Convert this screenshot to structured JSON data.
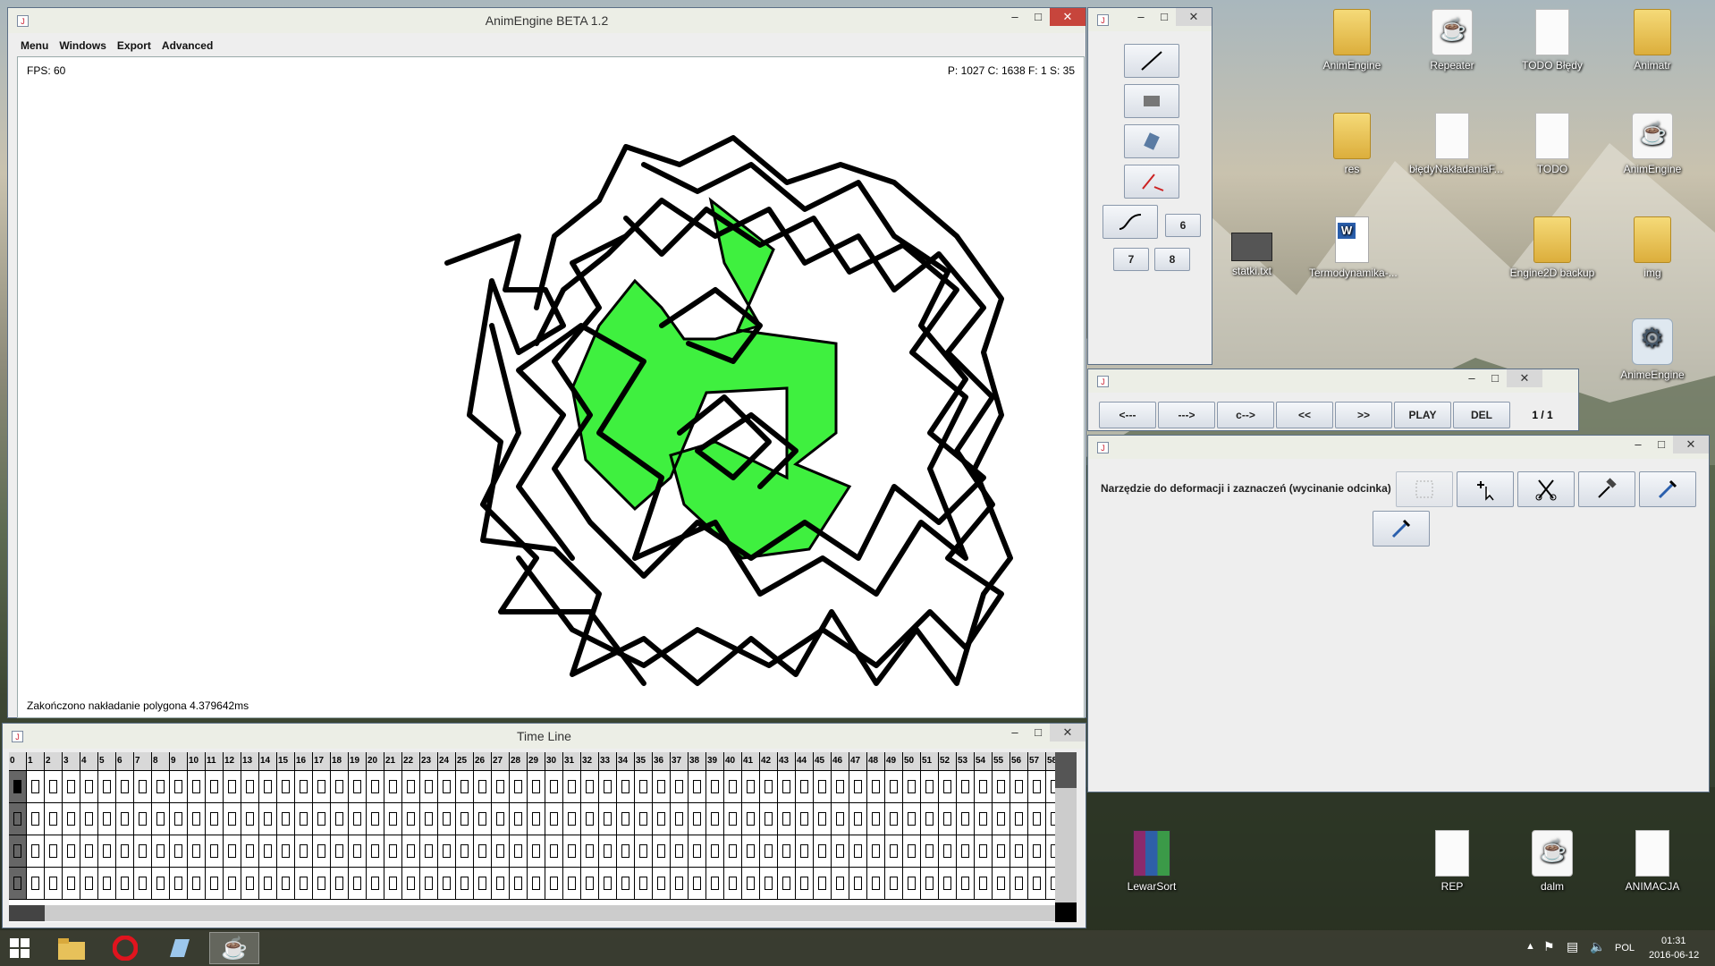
{
  "main_window": {
    "title": "AnimEngine BETA 1.2",
    "menu": [
      "Menu",
      "Windows",
      "Export",
      "Advanced"
    ],
    "fps": "FPS: 60",
    "stats": "P: 1027 C: 1638 F: 1 S: 35",
    "status": "Zakończono nakładanie polygona 4.379642ms"
  },
  "tools_window": {
    "tools": [
      "line-tool-icon",
      "image-tool-icon",
      "eraser-tool-icon",
      "pen-tool-icon",
      "curve-tool-icon"
    ],
    "numbered_buttons": [
      "6",
      "7",
      "8"
    ]
  },
  "playback_window": {
    "buttons": [
      "<---",
      "--->",
      "c-->",
      "<<",
      ">>",
      "PLAY",
      "DEL"
    ],
    "frame_counter": "1 / 1"
  },
  "deform_window": {
    "label": "Narzędzie do deformacji i zaznaczeń (wycinanie odcinka)",
    "tools": [
      "select-rect-icon",
      "add-point-icon",
      "cut-icon",
      "hammer-icon",
      "pipette-icon",
      "pipette-icon"
    ]
  },
  "timeline_window": {
    "title": "Time Line",
    "frame_numbers": [
      "0",
      "1",
      "2",
      "3",
      "4",
      "5",
      "6",
      "7",
      "8",
      "9",
      "10",
      "11",
      "12",
      "13",
      "14",
      "15",
      "16",
      "17",
      "18",
      "19",
      "20",
      "21",
      "22",
      "23",
      "24",
      "25",
      "26",
      "27",
      "28",
      "29",
      "30",
      "31",
      "32",
      "33",
      "34",
      "35",
      "36",
      "37",
      "38",
      "39",
      "40",
      "41",
      "42",
      "43",
      "44",
      "45",
      "46",
      "47",
      "48",
      "49",
      "50",
      "51",
      "52",
      "53",
      "54",
      "55",
      "56",
      "57",
      "58"
    ],
    "layer_count": 4
  },
  "desktop_icons": [
    {
      "label": "AnimEngine",
      "type": "folder"
    },
    {
      "label": "Repeater",
      "type": "java"
    },
    {
      "label": "TODO Błędy",
      "type": "doc"
    },
    {
      "label": "Animatr",
      "type": "folder"
    },
    {
      "label": "res",
      "type": "folder"
    },
    {
      "label": "błędyNakładaniaF...",
      "type": "doc"
    },
    {
      "label": "TODO",
      "type": "doc"
    },
    {
      "label": "AnimEngine",
      "type": "java"
    },
    {
      "label": "statki.txt",
      "type": "printer"
    },
    {
      "label": "Termodynamika-...",
      "type": "word"
    },
    {
      "label": "Engine2D backup",
      "type": "folder"
    },
    {
      "label": "img",
      "type": "folder"
    },
    {
      "label": "AnimeEngine",
      "type": "gear"
    },
    {
      "label": "LewarSort",
      "type": "rar"
    },
    {
      "label": "REP",
      "type": "doc"
    },
    {
      "label": "dalm",
      "type": "java"
    },
    {
      "label": "ANIMACJA",
      "type": "doc"
    }
  ],
  "taskbar": {
    "apps": [
      "file-explorer-icon",
      "opera-icon",
      "app-icon",
      "java-icon"
    ],
    "language": "POL",
    "time": "01:31",
    "date": "2016-06-12"
  },
  "colors": {
    "fill_green": "#3ff03f",
    "accent_close": "#c7453c"
  }
}
